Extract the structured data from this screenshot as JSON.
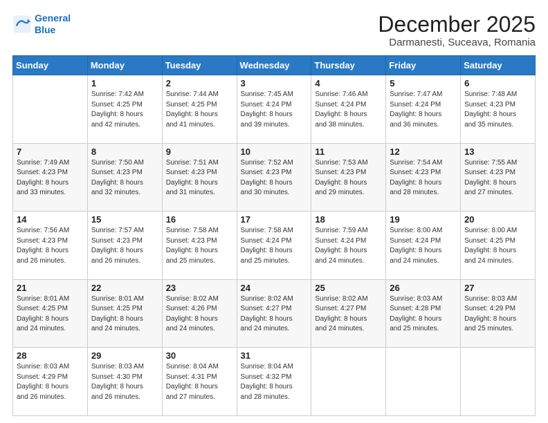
{
  "logo": {
    "line1": "General",
    "line2": "Blue"
  },
  "title": "December 2025",
  "location": "Darmanesti, Suceava, Romania",
  "weekdays": [
    "Sunday",
    "Monday",
    "Tuesday",
    "Wednesday",
    "Thursday",
    "Friday",
    "Saturday"
  ],
  "weeks": [
    [
      {
        "day": "",
        "info": ""
      },
      {
        "day": "1",
        "info": "Sunrise: 7:42 AM\nSunset: 4:25 PM\nDaylight: 8 hours\nand 42 minutes."
      },
      {
        "day": "2",
        "info": "Sunrise: 7:44 AM\nSunset: 4:25 PM\nDaylight: 8 hours\nand 41 minutes."
      },
      {
        "day": "3",
        "info": "Sunrise: 7:45 AM\nSunset: 4:24 PM\nDaylight: 8 hours\nand 39 minutes."
      },
      {
        "day": "4",
        "info": "Sunrise: 7:46 AM\nSunset: 4:24 PM\nDaylight: 8 hours\nand 38 minutes."
      },
      {
        "day": "5",
        "info": "Sunrise: 7:47 AM\nSunset: 4:24 PM\nDaylight: 8 hours\nand 36 minutes."
      },
      {
        "day": "6",
        "info": "Sunrise: 7:48 AM\nSunset: 4:23 PM\nDaylight: 8 hours\nand 35 minutes."
      }
    ],
    [
      {
        "day": "7",
        "info": "Sunrise: 7:49 AM\nSunset: 4:23 PM\nDaylight: 8 hours\nand 33 minutes."
      },
      {
        "day": "8",
        "info": "Sunrise: 7:50 AM\nSunset: 4:23 PM\nDaylight: 8 hours\nand 32 minutes."
      },
      {
        "day": "9",
        "info": "Sunrise: 7:51 AM\nSunset: 4:23 PM\nDaylight: 8 hours\nand 31 minutes."
      },
      {
        "day": "10",
        "info": "Sunrise: 7:52 AM\nSunset: 4:23 PM\nDaylight: 8 hours\nand 30 minutes."
      },
      {
        "day": "11",
        "info": "Sunrise: 7:53 AM\nSunset: 4:23 PM\nDaylight: 8 hours\nand 29 minutes."
      },
      {
        "day": "12",
        "info": "Sunrise: 7:54 AM\nSunset: 4:23 PM\nDaylight: 8 hours\nand 28 minutes."
      },
      {
        "day": "13",
        "info": "Sunrise: 7:55 AM\nSunset: 4:23 PM\nDaylight: 8 hours\nand 27 minutes."
      }
    ],
    [
      {
        "day": "14",
        "info": "Sunrise: 7:56 AM\nSunset: 4:23 PM\nDaylight: 8 hours\nand 26 minutes."
      },
      {
        "day": "15",
        "info": "Sunrise: 7:57 AM\nSunset: 4:23 PM\nDaylight: 8 hours\nand 26 minutes."
      },
      {
        "day": "16",
        "info": "Sunrise: 7:58 AM\nSunset: 4:23 PM\nDaylight: 8 hours\nand 25 minutes."
      },
      {
        "day": "17",
        "info": "Sunrise: 7:58 AM\nSunset: 4:24 PM\nDaylight: 8 hours\nand 25 minutes."
      },
      {
        "day": "18",
        "info": "Sunrise: 7:59 AM\nSunset: 4:24 PM\nDaylight: 8 hours\nand 24 minutes."
      },
      {
        "day": "19",
        "info": "Sunrise: 8:00 AM\nSunset: 4:24 PM\nDaylight: 8 hours\nand 24 minutes."
      },
      {
        "day": "20",
        "info": "Sunrise: 8:00 AM\nSunset: 4:25 PM\nDaylight: 8 hours\nand 24 minutes."
      }
    ],
    [
      {
        "day": "21",
        "info": "Sunrise: 8:01 AM\nSunset: 4:25 PM\nDaylight: 8 hours\nand 24 minutes."
      },
      {
        "day": "22",
        "info": "Sunrise: 8:01 AM\nSunset: 4:25 PM\nDaylight: 8 hours\nand 24 minutes."
      },
      {
        "day": "23",
        "info": "Sunrise: 8:02 AM\nSunset: 4:26 PM\nDaylight: 8 hours\nand 24 minutes."
      },
      {
        "day": "24",
        "info": "Sunrise: 8:02 AM\nSunset: 4:27 PM\nDaylight: 8 hours\nand 24 minutes."
      },
      {
        "day": "25",
        "info": "Sunrise: 8:02 AM\nSunset: 4:27 PM\nDaylight: 8 hours\nand 24 minutes."
      },
      {
        "day": "26",
        "info": "Sunrise: 8:03 AM\nSunset: 4:28 PM\nDaylight: 8 hours\nand 25 minutes."
      },
      {
        "day": "27",
        "info": "Sunrise: 8:03 AM\nSunset: 4:29 PM\nDaylight: 8 hours\nand 25 minutes."
      }
    ],
    [
      {
        "day": "28",
        "info": "Sunrise: 8:03 AM\nSunset: 4:29 PM\nDaylight: 8 hours\nand 26 minutes."
      },
      {
        "day": "29",
        "info": "Sunrise: 8:03 AM\nSunset: 4:30 PM\nDaylight: 8 hours\nand 26 minutes."
      },
      {
        "day": "30",
        "info": "Sunrise: 8:04 AM\nSunset: 4:31 PM\nDaylight: 8 hours\nand 27 minutes."
      },
      {
        "day": "31",
        "info": "Sunrise: 8:04 AM\nSunset: 4:32 PM\nDaylight: 8 hours\nand 28 minutes."
      },
      {
        "day": "",
        "info": ""
      },
      {
        "day": "",
        "info": ""
      },
      {
        "day": "",
        "info": ""
      }
    ]
  ]
}
